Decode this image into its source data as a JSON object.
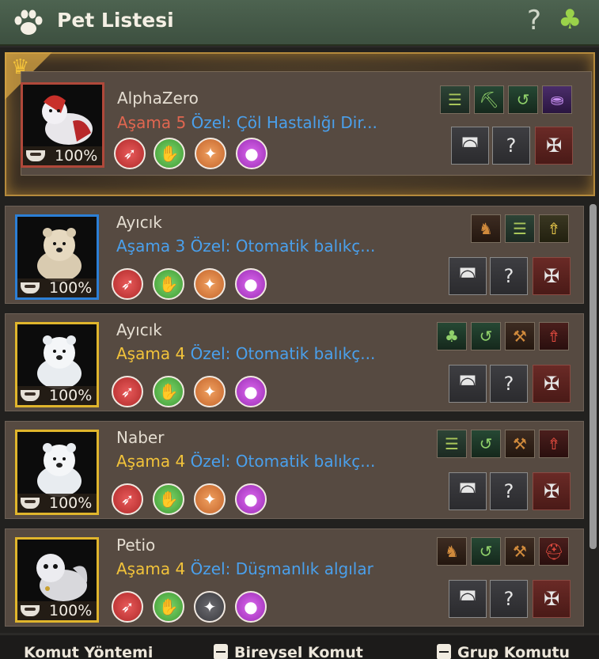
{
  "window": {
    "title": "Pet Listesi",
    "paw_icon": "paw-icon",
    "help_label": "?",
    "clover_icon": "clover-icon"
  },
  "pets": [
    {
      "name": "AlphaZero",
      "stage_label": "Aşama",
      "stage_value": "5",
      "special": "Özel: Çöl Hastalığı Dir...",
      "feed": "100%",
      "featured": true,
      "talents": [
        "stack-icon",
        "pickaxe-icon",
        "gather-icon",
        "bag-icon"
      ],
      "talent_glyphs": [
        "☰",
        "⛏",
        "↺",
        "⛂"
      ]
    },
    {
      "name": "Ayıcık",
      "stage_label": "Aşama",
      "stage_value": "3",
      "special": "Özel: Otomatik balıkç...",
      "feed": "100%",
      "talents": [
        "horse-icon",
        "stack-icon",
        "person-up-icon"
      ],
      "talent_glyphs": [
        "♞",
        "☰",
        "⇮"
      ]
    },
    {
      "name": "Ayıcık",
      "stage_label": "Aşama",
      "stage_value": "4",
      "special": "Özel: Otomatik balıkç...",
      "feed": "100%",
      "talents": [
        "clover-icon",
        "gather-icon",
        "axe-icon",
        "person-up-icon"
      ],
      "talent_glyphs": [
        "♣",
        "↺",
        "⚒",
        "⇮"
      ]
    },
    {
      "name": "Naber",
      "stage_label": "Aşama",
      "stage_value": "4",
      "special": "Özel: Otomatik balıkç...",
      "feed": "100%",
      "talents": [
        "stack-icon",
        "gather-icon",
        "axe-icon",
        "person-up-icon"
      ],
      "talent_glyphs": [
        "☰",
        "↺",
        "⚒",
        "⇮"
      ]
    },
    {
      "name": "Petio",
      "stage_label": "Aşama",
      "stage_value": "4",
      "special": "Özel: Düşmanlık algılar",
      "feed": "100%",
      "talents": [
        "horse-icon",
        "gather-icon",
        "axe-icon",
        "helmet-icon"
      ],
      "talent_glyphs": [
        "♞",
        "↺",
        "⚒",
        "⛑"
      ]
    }
  ],
  "skill_icons": [
    "run-icon",
    "hand-icon",
    "compass-icon",
    "sack-icon"
  ],
  "action_buttons": [
    "feed-bowl-icon",
    "paw-question-icon",
    "release-icon"
  ],
  "footer": {
    "method": "Komut Yöntemi",
    "individual": "Bireysel Komut",
    "group": "Grup Komutu"
  },
  "colors": {
    "titlebar": "#4d6350",
    "gold_frame": "#e0b52c",
    "blue_frame": "#2c7fd6",
    "stage_gold": "#f2c33a",
    "stage_blue": "#4aa0ec",
    "stage_red": "#e06650"
  }
}
